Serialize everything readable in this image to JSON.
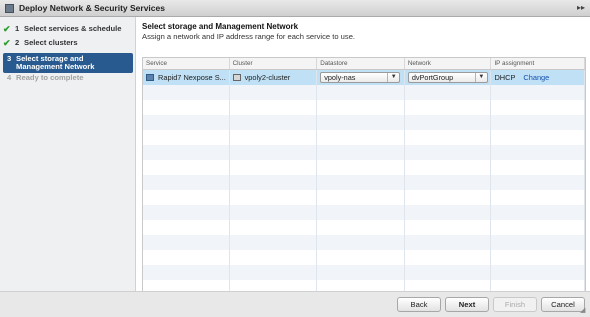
{
  "window": {
    "title": "Deploy Network & Security Services"
  },
  "steps": [
    {
      "number": "1",
      "label": "Select services & schedule",
      "state": "done"
    },
    {
      "number": "2",
      "label": "Select clusters",
      "state": "done"
    },
    {
      "number": "3",
      "label_line1": "Select storage and",
      "label_line2": "Management Network",
      "state": "active"
    },
    {
      "number": "4",
      "label": "Ready to complete",
      "state": "disabled"
    }
  ],
  "content": {
    "heading": "Select storage and Management Network",
    "subheading": "Assign a network and IP address range for each service to use."
  },
  "table": {
    "columns": [
      "Service",
      "Cluster",
      "Datastore",
      "Network",
      "IP assignment"
    ],
    "rows": [
      {
        "service": "Rapid7 Nexpose S...",
        "cluster": "vpoly2-cluster",
        "datastore": "vpoly-nas",
        "network": "dvPortGroup",
        "ip_assignment": "DHCP",
        "ip_action": "Change"
      }
    ]
  },
  "footer": {
    "back": "Back",
    "next": "Next",
    "finish": "Finish",
    "cancel": "Cancel"
  },
  "colors": {
    "active_step": "#295a8f",
    "selected_row": "#bfe0f5",
    "link": "#1550b0",
    "check": "#2c9c2c"
  },
  "icons": {
    "done_step": "check-icon",
    "service": "vm-icon",
    "cluster": "cluster-icon",
    "dropdown": "chevron-down-icon"
  }
}
